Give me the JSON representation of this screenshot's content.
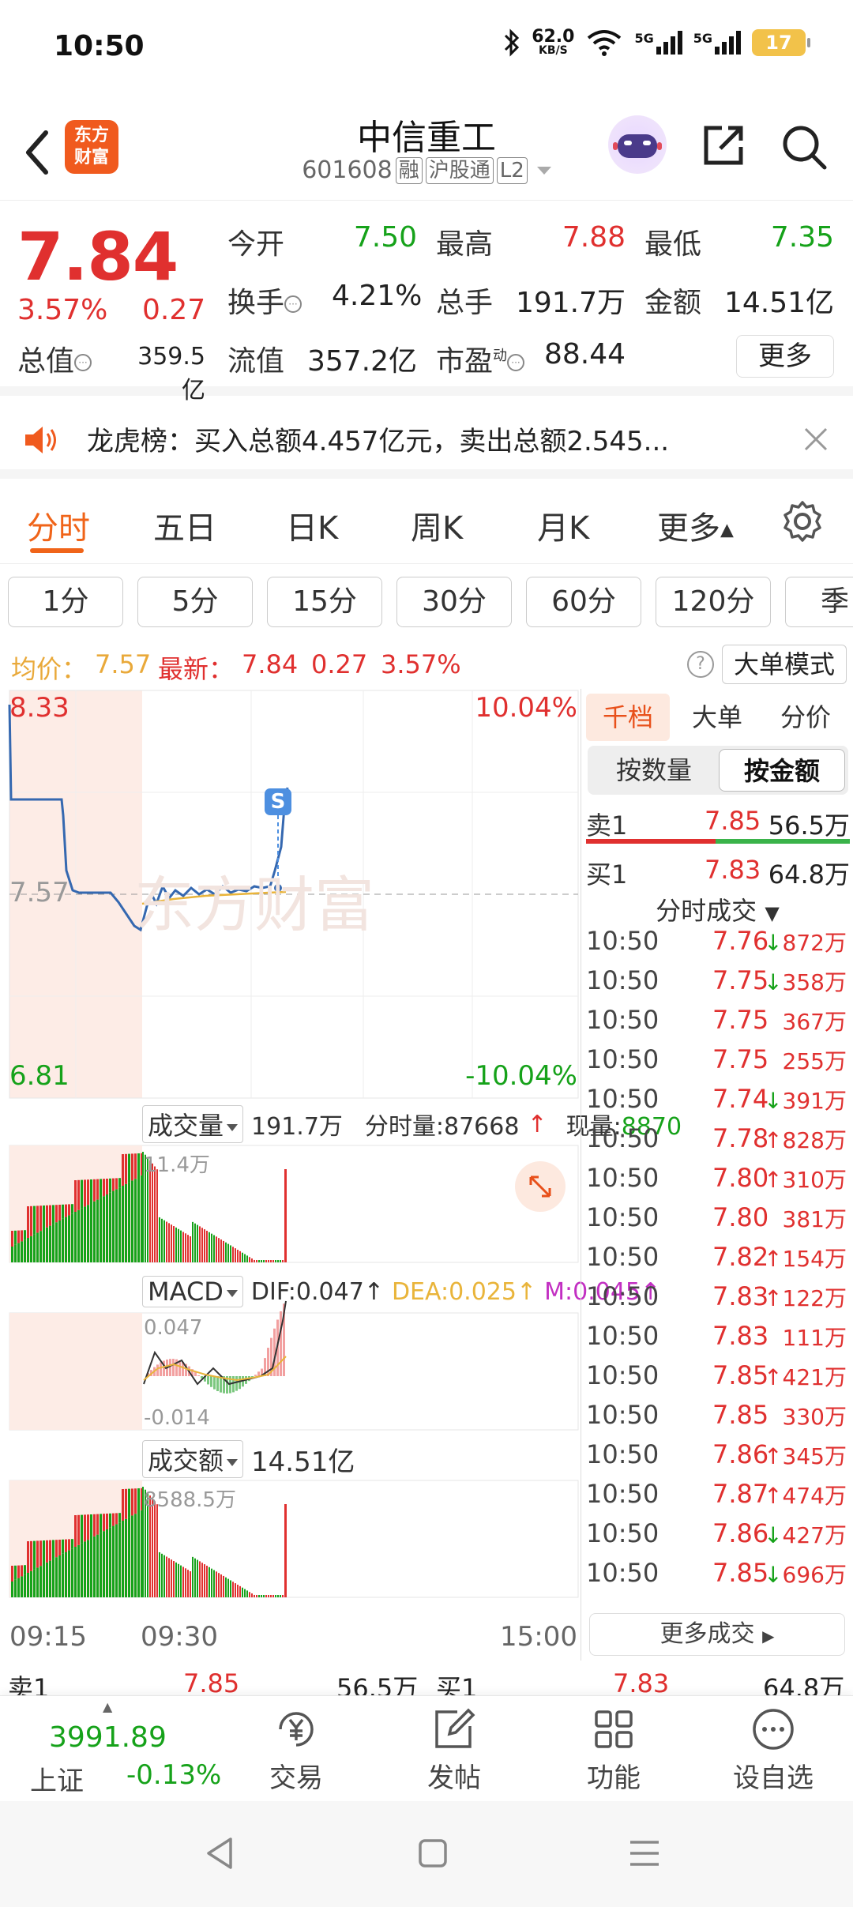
{
  "status": {
    "time": "10:50",
    "net_speed": "62.0",
    "net_unit": "KB/S",
    "signal1": "5G",
    "signal2": "5G",
    "battery": "17"
  },
  "header": {
    "stock_name": "中信重工",
    "code": "601608",
    "tag_margin": "融",
    "tag_connect": "沪股通",
    "tag_level": "L2",
    "logo_line1": "东方",
    "logo_line2": "财富"
  },
  "quote": {
    "price": "7.84",
    "change_pct": "3.57%",
    "change": "0.27",
    "open_label": "今开",
    "open": "7.50",
    "high_label": "最高",
    "high": "7.88",
    "low_label": "最低",
    "low": "7.35",
    "turnover_label": "换手",
    "turnover": "4.21%",
    "volume_label": "总手",
    "volume": "191.7万",
    "amount_label": "金额",
    "amount": "14.51亿",
    "mktcap_label": "总值",
    "mktcap": "359.5亿",
    "float_label": "流值",
    "float": "357.2亿",
    "pe_label": "市盈",
    "pe_sup": "动",
    "pe": "88.44",
    "more_label": "更多"
  },
  "notice": {
    "text": "龙虎榜：买入总额4.457亿元，卖出总额2.545..."
  },
  "chart_tabs": [
    "分时",
    "五日",
    "日K",
    "周K",
    "月K",
    "更多"
  ],
  "periods": [
    "1分",
    "5分",
    "15分",
    "30分",
    "60分",
    "120分",
    "季"
  ],
  "avg": {
    "avg_label": "均价：",
    "avg_value": "7.57",
    "latest_label": "最新：",
    "latest_value": "7.84",
    "latest_change": "0.27",
    "latest_pct": "3.57%",
    "help": "?",
    "big_order_mode": "大单模式"
  },
  "chart": {
    "max_price": "8.33",
    "max_pct": "10.04%",
    "prev_close": "7.57",
    "min_price": "6.81",
    "min_pct": "-10.04%",
    "watermark": "东方财富",
    "marker": "S",
    "volume_header": {
      "select": "成交量",
      "total": "191.7万",
      "tick_label": "分时量:87668",
      "current_label": "现量:",
      "current": "8870",
      "axis_max": "11.4万"
    },
    "macd_header": {
      "select": "MACD",
      "dif": "DIF:0.047",
      "dea": "DEA:0.025",
      "m": "M:0.045",
      "axis_max": "0.047",
      "axis_min": "-0.014"
    },
    "amount_header": {
      "select": "成交额",
      "total": "14.51亿",
      "axis_max": "8588.5万"
    },
    "time_start": "09:15",
    "time_open": "09:30",
    "time_end": "15:00",
    "colors": {
      "price_line": "#3568b0",
      "avg_line": "#e9b43a",
      "up": "#e0302f",
      "down": "#16a21a",
      "preopen": "#fdece6"
    }
  },
  "orderbook": {
    "tabs": [
      "千档",
      "大单",
      "分价"
    ],
    "seg": [
      "按数量",
      "按金额"
    ],
    "sell1": {
      "label": "卖1",
      "price": "7.85",
      "amount": "56.5万"
    },
    "buy1": {
      "label": "买1",
      "price": "7.83",
      "amount": "64.8万"
    },
    "trades_title": "分时成交",
    "trades": [
      {
        "time": "10:50",
        "price": "7.76",
        "dir": "↓",
        "amount": "872万",
        "color": "green"
      },
      {
        "time": "10:50",
        "price": "7.75",
        "dir": "↓",
        "amount": "358万",
        "color": "green"
      },
      {
        "time": "10:50",
        "price": "7.75",
        "dir": "",
        "amount": "367万",
        "color": "red"
      },
      {
        "time": "10:50",
        "price": "7.75",
        "dir": "",
        "amount": "255万",
        "color": "red"
      },
      {
        "time": "10:50",
        "price": "7.74",
        "dir": "↓",
        "amount": "391万",
        "color": "green"
      },
      {
        "time": "10:50",
        "price": "7.78",
        "dir": "↑",
        "amount": "828万",
        "color": "red"
      },
      {
        "time": "10:50",
        "price": "7.80",
        "dir": "↑",
        "amount": "310万",
        "color": "red"
      },
      {
        "time": "10:50",
        "price": "7.80",
        "dir": "",
        "amount": "381万",
        "color": "red"
      },
      {
        "time": "10:50",
        "price": "7.82",
        "dir": "↑",
        "amount": "154万",
        "color": "red"
      },
      {
        "time": "10:50",
        "price": "7.83",
        "dir": "↑",
        "amount": "122万",
        "color": "red"
      },
      {
        "time": "10:50",
        "price": "7.83",
        "dir": "",
        "amount": "111万",
        "color": "red"
      },
      {
        "time": "10:50",
        "price": "7.85",
        "dir": "↑",
        "amount": "421万",
        "color": "red"
      },
      {
        "time": "10:50",
        "price": "7.85",
        "dir": "",
        "amount": "330万",
        "color": "red"
      },
      {
        "time": "10:50",
        "price": "7.86",
        "dir": "↑",
        "amount": "345万",
        "color": "red"
      },
      {
        "time": "10:50",
        "price": "7.87",
        "dir": "↑",
        "amount": "474万",
        "color": "red"
      },
      {
        "time": "10:50",
        "price": "7.86",
        "dir": "↓",
        "amount": "427万",
        "color": "green"
      },
      {
        "time": "10:50",
        "price": "7.85",
        "dir": "↓",
        "amount": "696万",
        "color": "green"
      }
    ],
    "more_trades": "更多成交"
  },
  "peek": {
    "sell1_label": "卖1",
    "sell1_price": "7.85",
    "sell1_amount": "56.5万",
    "buy1_label": "买1",
    "buy1_price": "7.83",
    "buy1_amount": "64.8万"
  },
  "bottom_nav": {
    "index_value": "3991.89",
    "index_name": "上证",
    "index_change": "-0.13%",
    "items": [
      "交易",
      "发帖",
      "功能",
      "设自选"
    ]
  }
}
